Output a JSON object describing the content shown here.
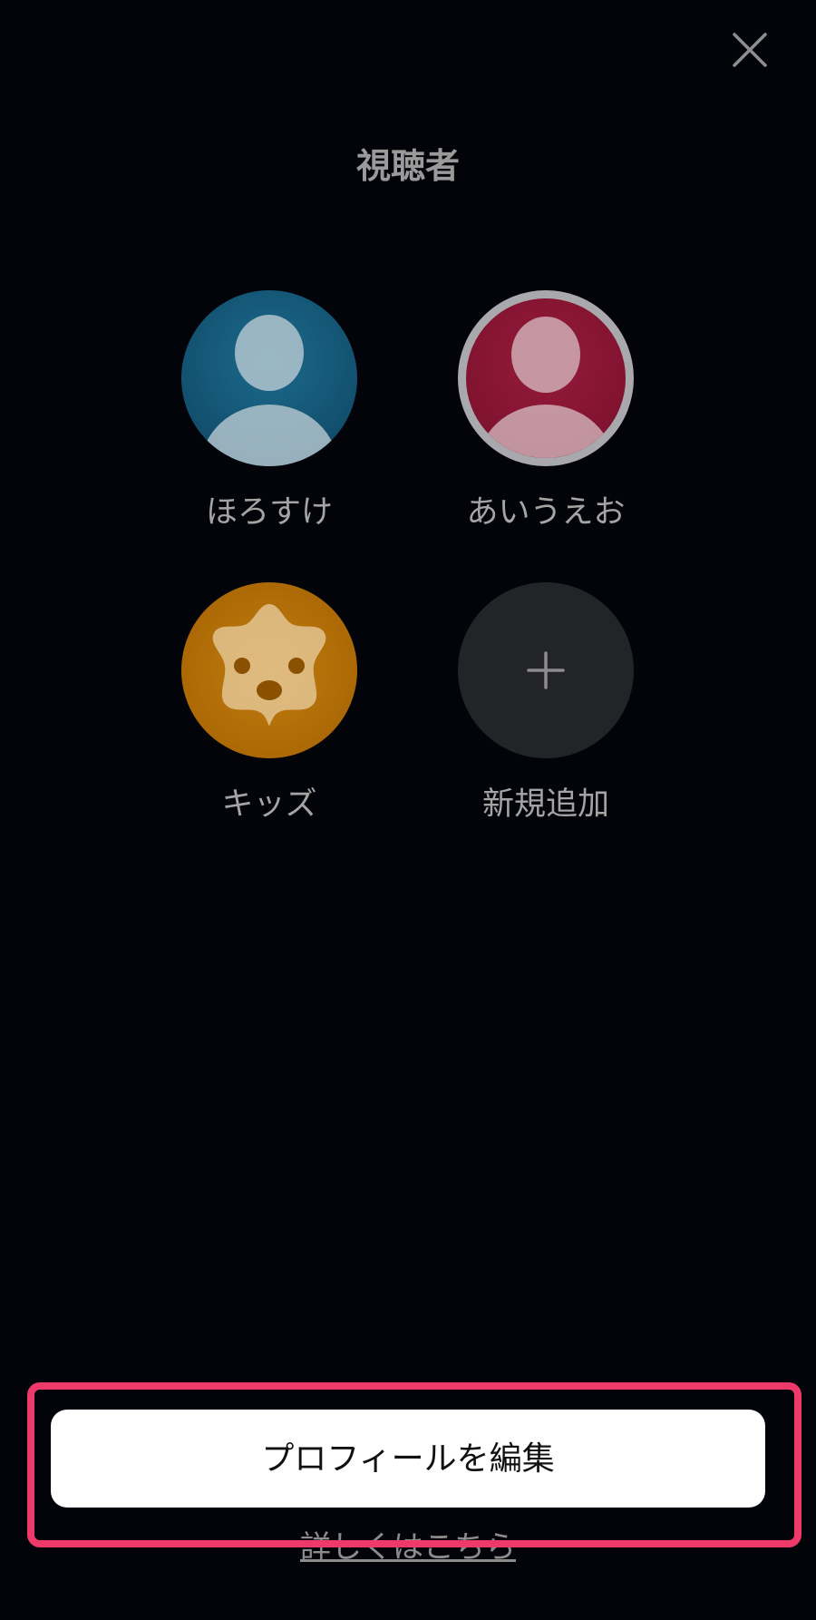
{
  "header": {
    "title": "視聴者",
    "close_icon": "close-icon"
  },
  "profiles": [
    {
      "name": "ほろすけ",
      "avatar": "person-avatar-icon",
      "color": "#135070"
    },
    {
      "name": "あいうえお",
      "avatar": "person-avatar-icon",
      "color": "#8a1533",
      "selected": true
    },
    {
      "name": "キッズ",
      "avatar": "kids-star-face-icon",
      "color": "#b06c08"
    },
    {
      "name": "新規追加",
      "avatar": "plus-icon",
      "color": "#232428"
    }
  ],
  "footer": {
    "edit_button_label": "プロフィールを編集",
    "more_link_label": "詳しくはこちら",
    "highlight_color": "#ee3a6a"
  }
}
